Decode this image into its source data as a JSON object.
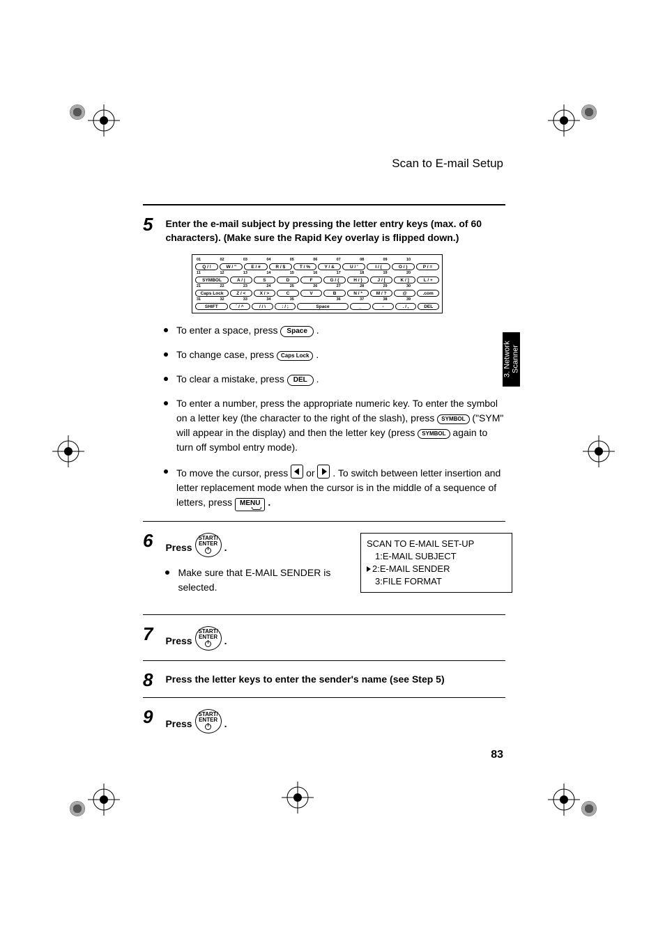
{
  "header": {
    "title": "Scan to E-mail Setup"
  },
  "sidetab": "3. Network Scanner",
  "page_number": "83",
  "steps": {
    "s5": {
      "num": "5",
      "text": "Enter the e-mail subject by pressing the letter entry keys (max. of 60 characters). (Make sure the Rapid Key overlay is flipped down.)"
    },
    "s6": {
      "num": "6",
      "text": "Press ",
      "sub_bullet": "Make sure that E-MAIL SENDER is selected."
    },
    "s7": {
      "num": "7",
      "text": "Press "
    },
    "s8": {
      "num": "8",
      "text": "Press the letter keys to enter the sender's name (see Step 5)"
    },
    "s9": {
      "num": "9",
      "text": "Press "
    }
  },
  "bullets": {
    "b1a": "To enter a space, press ",
    "b2a": "To change case, press ",
    "b3a": "To clear a mistake, press ",
    "b4a": "To enter a number, press the appropriate numeric key. To enter the symbol on a letter key (the character to the right of the slash), press ",
    "b4b": " (\"SYM\" will appear in the display) and then the letter key (press ",
    "b4c": " again to turn off symbol entry mode).",
    "b5a": "To move the cursor, press ",
    "b5b": " or ",
    "b5c": " . To switch between letter insertion and letter replacement mode when the cursor is in the middle of a sequence of letters, press "
  },
  "keys": {
    "space": "Space",
    "caps": "Caps Lock",
    "del": "DEL",
    "symbol": "SYMBOL",
    "menu": "MENU",
    "start1": "START/",
    "start2": "ENTER"
  },
  "lcd": {
    "l1": "SCAN TO E-MAIL SET-UP",
    "l2": "1:E-MAIL SUBJECT",
    "l3": "2:E-MAIL SENDER",
    "l4": "3:FILE FORMAT"
  },
  "keyboard": {
    "numrow1": [
      "01",
      "02",
      "03",
      "04",
      "05",
      "06",
      "07",
      "08",
      "09",
      "10"
    ],
    "row1": [
      "Q / !",
      "W / \"",
      "E / #",
      "R / $",
      "T / %",
      "Y / &",
      "U / '",
      "I / (",
      "O / )",
      "P / ="
    ],
    "numrow2": [
      "11",
      "12",
      "13",
      "14",
      "15",
      "16",
      "17",
      "18",
      "19",
      "20"
    ],
    "row2_lead": "SYMBOL",
    "row2": [
      "A / |",
      "S",
      "D",
      "F",
      "G / {",
      "H / }",
      "J / [",
      "K / ]",
      "L / +"
    ],
    "numrow3": [
      "21",
      "22",
      "23",
      "24",
      "25",
      "26",
      "27",
      "28",
      "29",
      "30"
    ],
    "row3_lead": "Caps Lock",
    "row3": [
      "Z / <",
      "X / >",
      "C",
      "V",
      "B",
      "N / *",
      "M / ?",
      "@",
      ".com"
    ],
    "numrow4": [
      "31",
      "32",
      "33",
      "34",
      "35",
      "",
      "36",
      "37",
      "38",
      "39"
    ],
    "row4_lead": "SHIFT",
    "row4": [
      "´ / ^",
      "/ / \\",
      ": / ;",
      "Space",
      "_",
      "-",
      ". / ,",
      "DEL"
    ]
  }
}
